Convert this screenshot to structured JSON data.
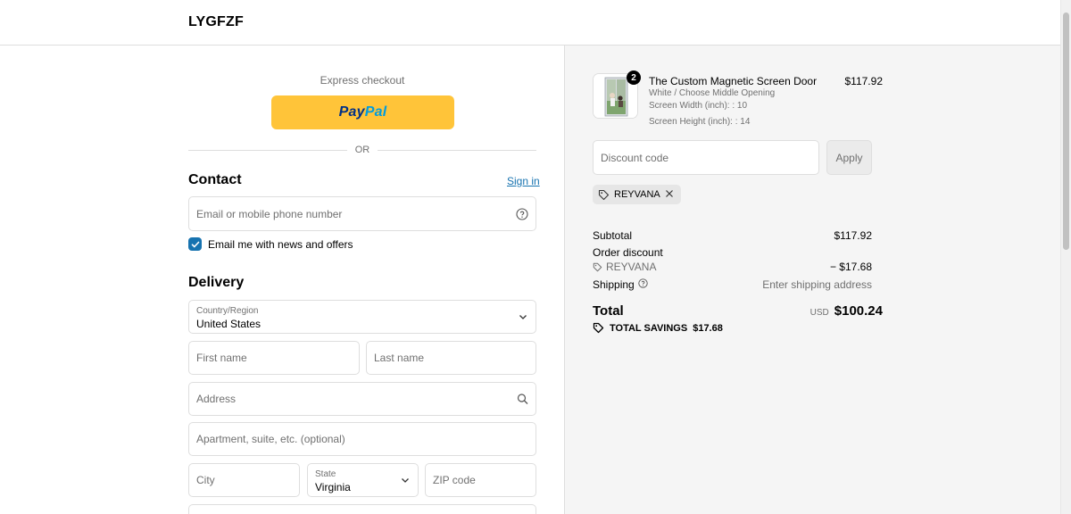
{
  "header": {
    "brand": "LYGFZF"
  },
  "express": {
    "label": "Express checkout",
    "paypal_part1": "Pay",
    "paypal_part2": "Pal",
    "or_label": "OR"
  },
  "contact": {
    "title": "Contact",
    "sign_in": "Sign in",
    "email_placeholder": "Email or mobile phone number",
    "newsletter_label": "Email me with news and offers",
    "newsletter_checked": true
  },
  "delivery": {
    "title": "Delivery",
    "country_label": "Country/Region",
    "country_value": "United States",
    "first_name_placeholder": "First name",
    "last_name_placeholder": "Last name",
    "address_placeholder": "Address",
    "apartment_placeholder": "Apartment, suite, etc. (optional)",
    "city_placeholder": "City",
    "state_label": "State",
    "state_value": "Virginia",
    "zip_placeholder": "ZIP code"
  },
  "order": {
    "item": {
      "quantity": "2",
      "title": "The Custom Magnetic Screen Door",
      "variant": "White / Choose Middle Opening",
      "width": "Screen Width (inch): : 10",
      "height": "Screen Height (inch): : 14",
      "price": "$117.92"
    },
    "discount_placeholder": "Discount code",
    "apply_label": "Apply",
    "applied_code": "REYVANA",
    "subtotal_label": "Subtotal",
    "subtotal_value": "$117.92",
    "order_discount_label": "Order discount",
    "discount_code_label": "REYVANA",
    "discount_value": "− $17.68",
    "shipping_label": "Shipping",
    "shipping_value": "Enter shipping address",
    "total_label": "Total",
    "currency": "USD",
    "total_value": "$100.24",
    "savings_label": "TOTAL SAVINGS",
    "savings_value": "$17.68"
  },
  "colors": {
    "accent": "#1773b0",
    "paypal_yellow": "#ffc439",
    "panel_bg": "#f5f5f5"
  }
}
